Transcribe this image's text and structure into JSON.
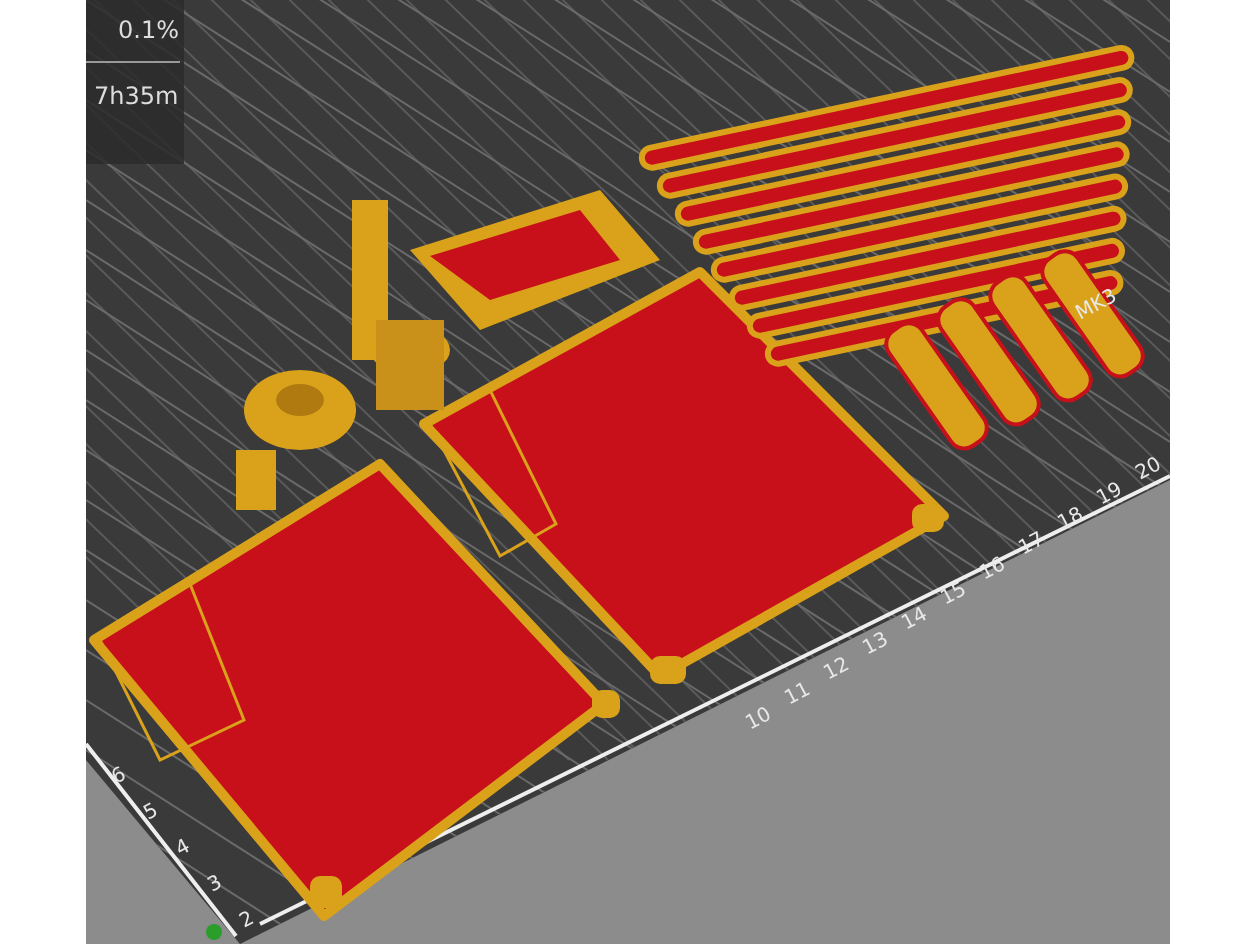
{
  "stats_panel": {
    "values": [
      "0.1%",
      "7h35m"
    ]
  },
  "bed": {
    "model_label": "MK3",
    "x_ticks": [
      "10",
      "11",
      "12",
      "13",
      "14",
      "15",
      "16",
      "17",
      "18",
      "19",
      "20"
    ],
    "y_ticks": [
      "6",
      "5",
      "4",
      "3",
      "2"
    ]
  }
}
